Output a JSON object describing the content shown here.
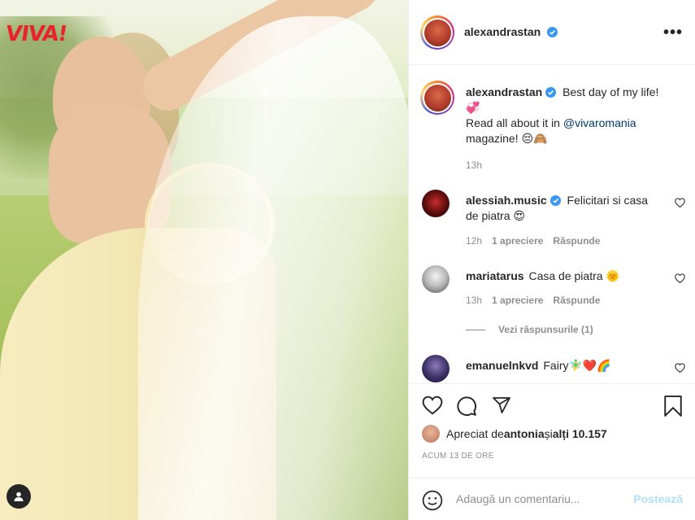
{
  "photo": {
    "logo_text": "VIVA!",
    "logo_color": "#e8242b",
    "tag_icon": "user-tag-icon"
  },
  "post": {
    "username": "alexandrastan",
    "verified_icon": "verified-badge-icon",
    "more_icon": "more-options-icon",
    "more_label": "•••"
  },
  "caption": {
    "username": "alexandrastan",
    "line1": "Best day of my life!",
    "heart_emoji": "💞",
    "line2_prefix": "Read all about it in ",
    "mention": "@vivaromania",
    "line3": "magazine! 😔🙈",
    "time": "13h"
  },
  "comments": [
    {
      "username": "alessiah.music",
      "verified": true,
      "text": "Felicitari si casa de piatra 😍",
      "time": "12h",
      "likes": "1 apreciere",
      "reply": "Răspunde"
    },
    {
      "username": "mariatarus",
      "verified": false,
      "text": "Casa de piatra 🌞",
      "time": "13h",
      "likes": "1 apreciere",
      "reply": "Răspunde",
      "view_replies": "Vezi răspunsurile (1)"
    },
    {
      "username": "emanuelnkvd",
      "verified": false,
      "text": "Fairy🧚‍♂️❤️🌈"
    }
  ],
  "actions": {
    "like_icon": "heart-icon",
    "comment_icon": "comment-icon",
    "share_icon": "share-icon",
    "save_icon": "bookmark-icon"
  },
  "likes": {
    "prefix": "Apreciat de ",
    "user": "antonia",
    "middle": " și ",
    "others": "alți 10.157"
  },
  "timestamp": "ACUM 13 DE ORE",
  "add_comment": {
    "emoji_icon": "emoji-icon",
    "placeholder": "Adaugă un comentariu...",
    "post_label": "Postează"
  },
  "colors": {
    "link": "#00376b",
    "muted": "#8e8e8e",
    "verified": "#3897f0",
    "post_disabled": "#b2dffc"
  }
}
